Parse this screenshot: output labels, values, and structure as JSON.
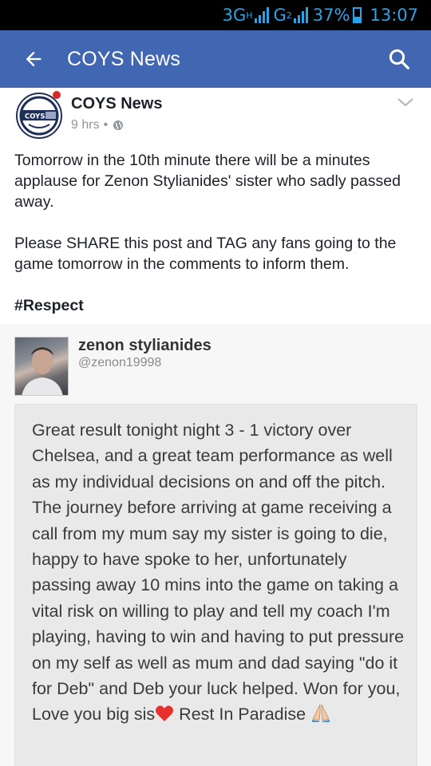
{
  "status_bar": {
    "network_1": "3G",
    "network_1_sup": "H",
    "network_2": "G",
    "network_2_sup": "2",
    "battery": "37%",
    "time": "13:07"
  },
  "app_bar": {
    "title": "COYS News",
    "back_icon": "arrow-left-icon",
    "search_icon": "search-icon",
    "background": "#4267b2"
  },
  "post": {
    "page_name": "COYS News",
    "time_ago": "9 hrs",
    "separator": "•",
    "privacy_icon": "globe-icon",
    "paragraph_1": "Tomorrow in the 10th minute there will be a minutes applause for Zenon Stylianides' sister who sadly passed away.",
    "paragraph_2": "Please SHARE this post and TAG any fans going to the game tomorrow in the comments to inform them.",
    "hashtag": "#Respect"
  },
  "embedded_post": {
    "name": "zenon stylianides",
    "handle": "@zenon19998",
    "note_part_1": "Great result tonight night 3 - 1 victory over Chelsea, and a great team performance as well as my individual decisions on and off the pitch. The journey before arriving at game receiving a call from my mum say my sister is going to die, happy to have spoke to her, unfortunately passing away 10 mins into the game on taking a vital risk on willing to play and tell my coach I'm playing, having to win and having to put pressure on my self as well as mum and dad saying \"do it for Deb\" and Deb your luck helped. Won for you, Love you big sis",
    "note_part_2": " Rest In Paradise ",
    "heart_icon": "heart-emoji-icon",
    "hands_icon": "praying-hands-emoji-icon"
  }
}
